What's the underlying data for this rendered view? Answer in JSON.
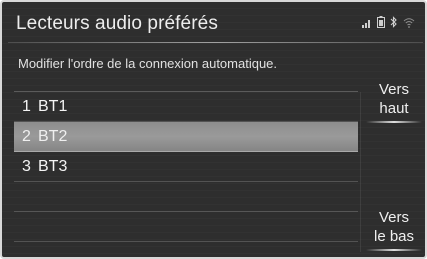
{
  "header": {
    "title": "Lecteurs audio préférés",
    "status_icons": [
      "signal-strength-icon",
      "battery-icon",
      "bluetooth-icon",
      "wifi-icon"
    ]
  },
  "main": {
    "subtitle": "Modifier l'ordre de la connexion automatique.",
    "devices": [
      {
        "number": "1",
        "name": "BT1",
        "selected": false
      },
      {
        "number": "2",
        "name": "BT2",
        "selected": true
      },
      {
        "number": "3",
        "name": "BT3",
        "selected": false
      }
    ]
  },
  "buttons": {
    "up_line1": "Vers",
    "up_line2": "haut",
    "down_line1": "Vers",
    "down_line2": "le bas"
  },
  "colors": {
    "background": "#2e2e2e",
    "selected_row": "#8d8d8d",
    "text": "#ededed"
  }
}
